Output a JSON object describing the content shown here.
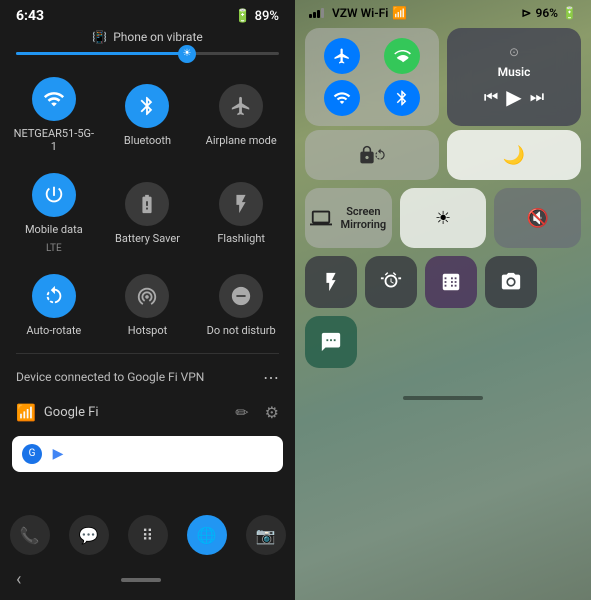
{
  "android": {
    "status": {
      "time": "6:43",
      "battery": "89%"
    },
    "vibrate_label": "Phone on vibrate",
    "tiles": [
      {
        "id": "wifi",
        "label": "NETGEAR51-5G-1",
        "sublabel": "",
        "active": true,
        "icon": "▼"
      },
      {
        "id": "bluetooth",
        "label": "Bluetooth",
        "sublabel": "",
        "active": true,
        "icon": "✦"
      },
      {
        "id": "airplane",
        "label": "Airplane mode",
        "sublabel": "",
        "active": false,
        "icon": "✈"
      },
      {
        "id": "mobile",
        "label": "Mobile data",
        "sublabel": "LTE",
        "active": true,
        "icon": "↕"
      },
      {
        "id": "battery_saver",
        "label": "Battery Saver",
        "sublabel": "",
        "active": false,
        "icon": "🔋"
      },
      {
        "id": "flashlight",
        "label": "Flashlight",
        "sublabel": "",
        "active": false,
        "icon": "🔦"
      },
      {
        "id": "autorotate",
        "label": "Auto-rotate",
        "sublabel": "",
        "active": true,
        "icon": "⟳"
      },
      {
        "id": "hotspot",
        "label": "Hotspot",
        "sublabel": "",
        "active": false,
        "icon": "◎"
      },
      {
        "id": "dnd",
        "label": "Do not disturb",
        "sublabel": "",
        "active": false,
        "icon": "⊖"
      }
    ],
    "vpn_text": "Device connected to Google Fi VPN",
    "network_name": "Google Fi",
    "search_placeholder": ""
  },
  "ios": {
    "status": {
      "carrier": "VZW Wi-Fi",
      "battery": "96%"
    },
    "music": {
      "title": "Music"
    },
    "mirroring_label": "Screen\nMirroring",
    "connectivity": {
      "airplane": "✈",
      "cellular": "📶",
      "wifi": "wifi",
      "bluetooth": "bt"
    },
    "apps": {
      "flashlight": "🔦",
      "timer": "⏱",
      "calculator": "🧮",
      "camera": "📷"
    }
  }
}
